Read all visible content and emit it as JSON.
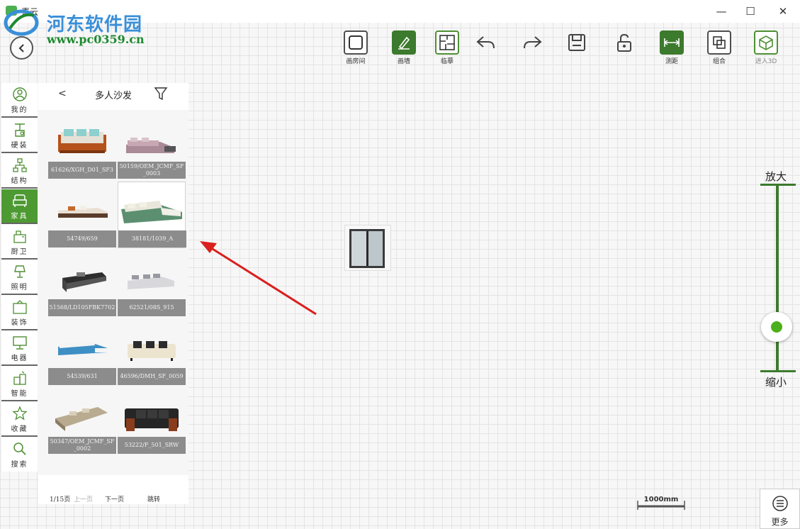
{
  "window": {
    "title": "喜云",
    "minimize_glyph": "—",
    "maximize_glyph": "☐",
    "close_glyph": "✕"
  },
  "watermark": {
    "site_name": "河东软件园",
    "url": "www.pc0359.cn"
  },
  "toolbar": {
    "items": [
      {
        "label": "画房间",
        "icon": "room-icon"
      },
      {
        "label": "画墙",
        "icon": "pencil-icon",
        "active": true
      },
      {
        "label": "临摹",
        "icon": "floorplan-icon"
      },
      {
        "label": "",
        "icon": "undo-icon"
      },
      {
        "label": "",
        "icon": "redo-icon"
      },
      {
        "label": "",
        "icon": "save-icon"
      },
      {
        "label": "",
        "icon": "unlock-icon"
      },
      {
        "label": "测距",
        "icon": "measure-icon",
        "active": true
      },
      {
        "label": "组合",
        "icon": "group-icon"
      },
      {
        "label": "进入3D",
        "icon": "cube-3d-icon"
      }
    ]
  },
  "categories": [
    {
      "label": "我的",
      "icon": "user-icon"
    },
    {
      "label": "硬装",
      "icon": "hard-decor-icon"
    },
    {
      "label": "结构",
      "icon": "structure-icon"
    },
    {
      "label": "家具",
      "icon": "sofa-icon",
      "active": true
    },
    {
      "label": "厨卫",
      "icon": "kitchen-icon"
    },
    {
      "label": "照明",
      "icon": "lamp-icon"
    },
    {
      "label": "装饰",
      "icon": "decor-icon"
    },
    {
      "label": "电器",
      "icon": "monitor-icon"
    },
    {
      "label": "智能",
      "icon": "smart-icon"
    },
    {
      "label": "收藏",
      "icon": "star-icon"
    },
    {
      "label": "搜索",
      "icon": "search-icon"
    }
  ],
  "panel": {
    "back_glyph": "<",
    "title": "多人沙发",
    "products": [
      {
        "code": "61626/XGH_D01_SF3"
      },
      {
        "code": "50159/OEM_JCMF_SF_0003"
      },
      {
        "code": "54749/659"
      },
      {
        "code": "38181/1039_A",
        "selected": true
      },
      {
        "code": "51568/LD105FBK7702"
      },
      {
        "code": "62521/08S_915"
      },
      {
        "code": "54539/631"
      },
      {
        "code": "46596/DMH_SF_0059"
      },
      {
        "code": "50347/OEM_JCMF_SF_0002"
      },
      {
        "code": "53222/F_501_SRW"
      }
    ],
    "pager": {
      "page_info": "1/15页",
      "prev": "上一页",
      "next": "下一页",
      "jump": "跳转"
    }
  },
  "zoom": {
    "zoom_in_label": "放大",
    "zoom_out_label": "缩小",
    "level": 0.2
  },
  "scale": {
    "label": "1000mm"
  },
  "more": {
    "label": "更多"
  },
  "colors": {
    "accent_green": "#3c7a2d",
    "active_category": "#4e9a32",
    "knob_dot": "#4caf1c",
    "annotation_arrow": "#d9201e",
    "watermark_blue": "#3a8fd8",
    "watermark_green": "#1d8a2f"
  }
}
